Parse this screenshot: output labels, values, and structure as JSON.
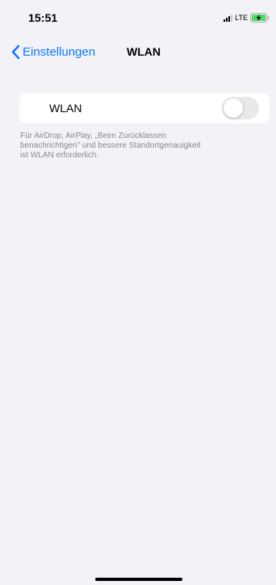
{
  "status_bar": {
    "time": "15:51",
    "network": "LTE",
    "signal_icon": "signal-bars-icon",
    "battery_icon": "battery-charging-icon",
    "battery_color": "#4cd964"
  },
  "nav": {
    "back_label": "Einstellungen",
    "back_icon": "chevron-left-icon",
    "title": "WLAN",
    "accent_color": "#0a7aff"
  },
  "wifi": {
    "label": "WLAN",
    "enabled": false,
    "footer_note": "Für AirDrop, AirPlay, „Beim Zurücklassen\nbenachrichtigen\" und bessere Standortgenauigkeit\nist WLAN erforderlich."
  }
}
